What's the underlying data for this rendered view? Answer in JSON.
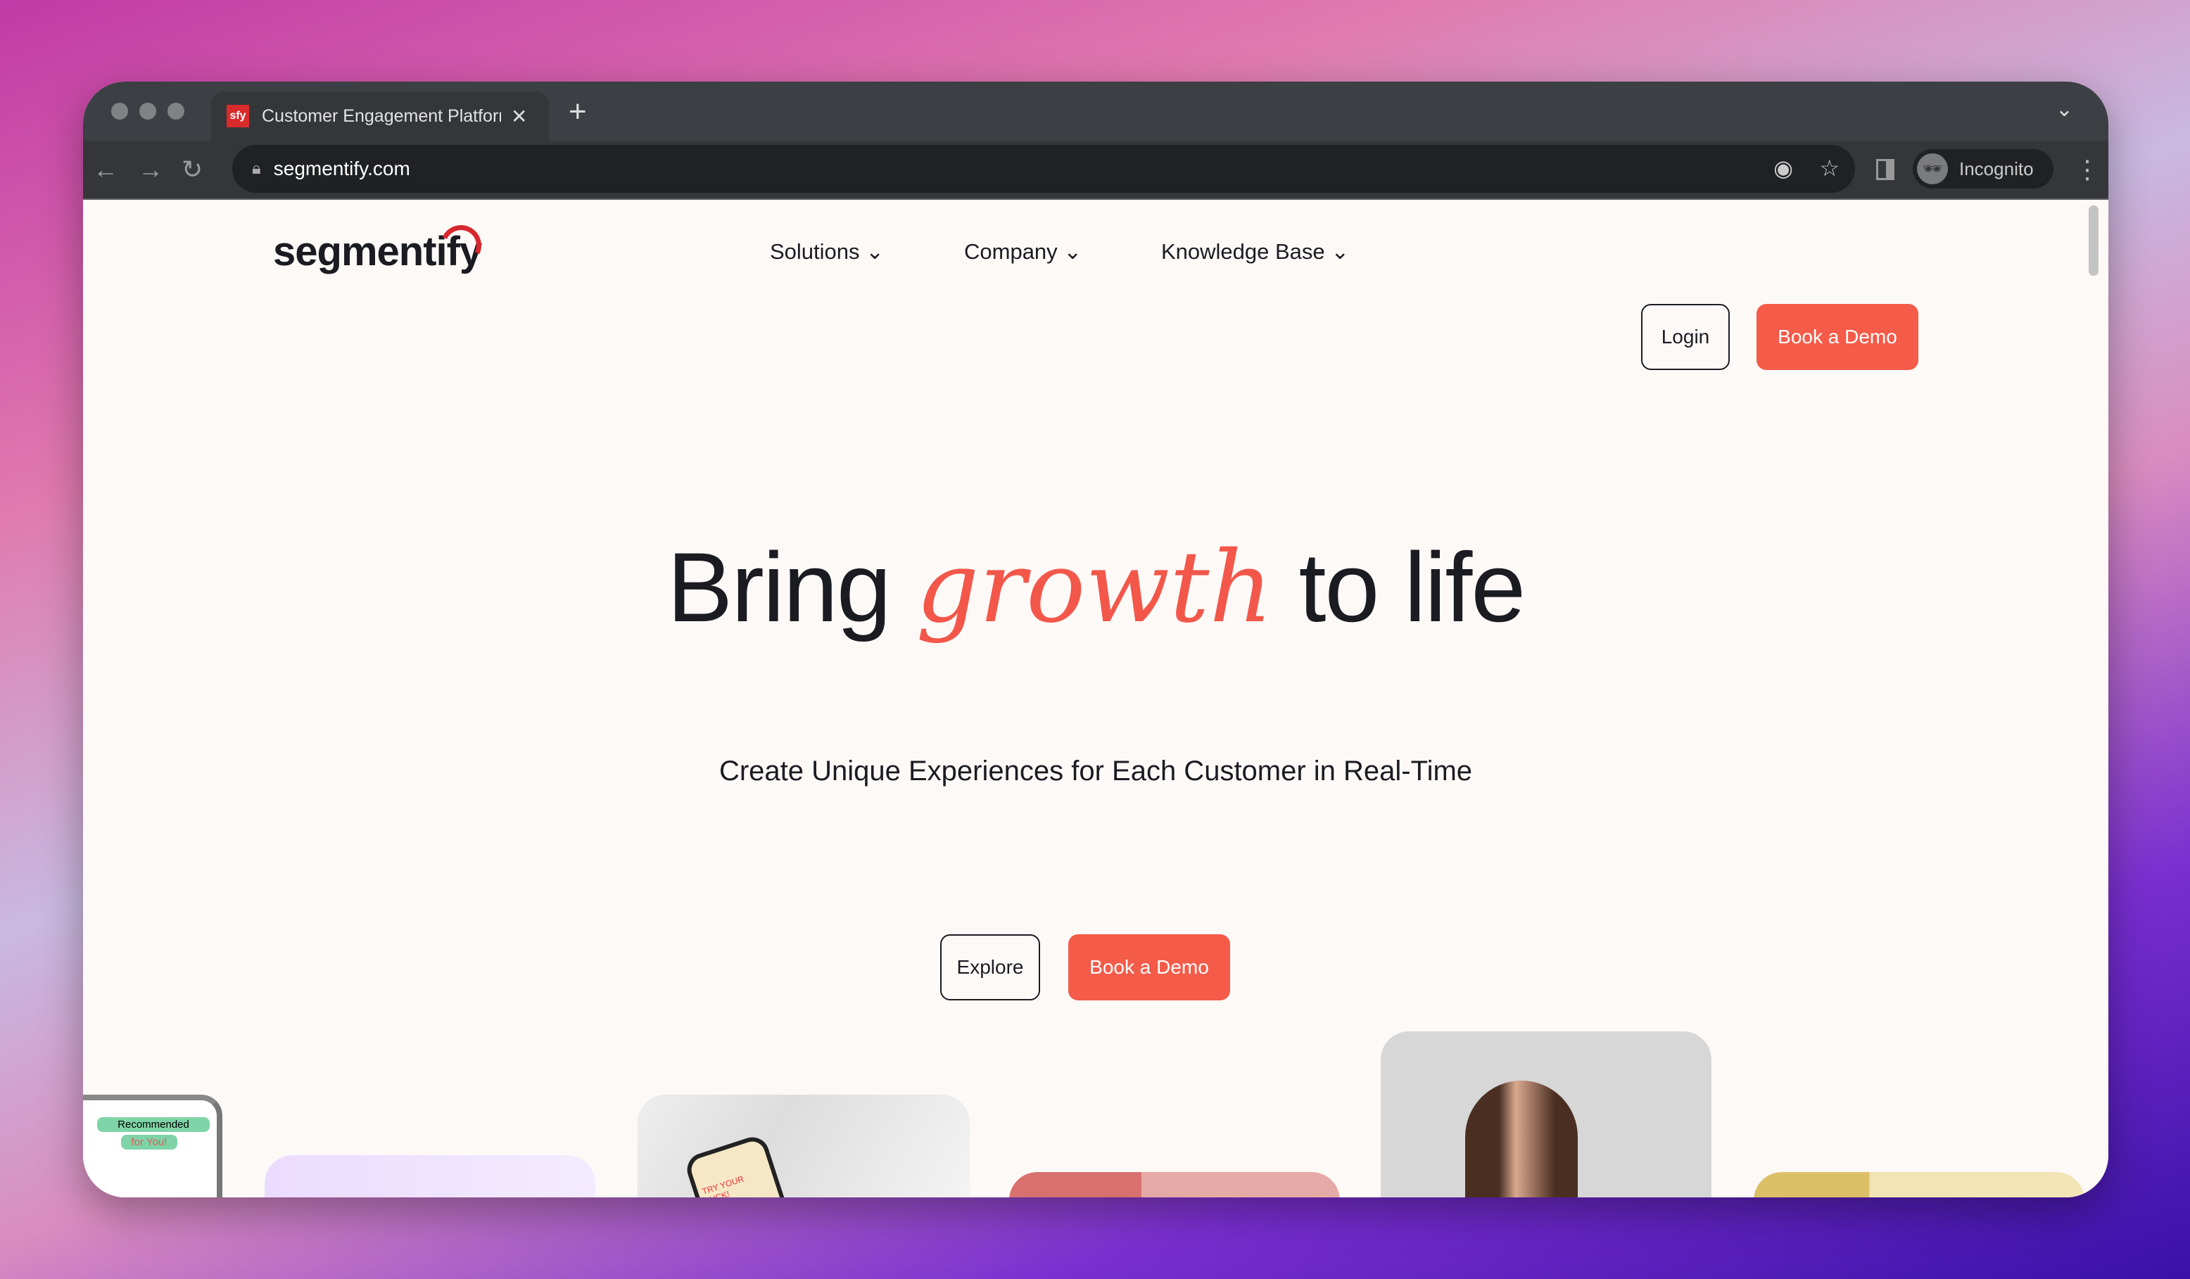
{
  "browser": {
    "tab_title": "Customer Engagement Platform",
    "favicon_text": "sfy",
    "url": "segmentify.com",
    "profile": "Incognito"
  },
  "site": {
    "logo": "segmentify",
    "nav": [
      {
        "label": "Solutions"
      },
      {
        "label": "Company"
      },
      {
        "label": "Knowledge Base"
      }
    ],
    "login": "Login",
    "book_demo": "Book a Demo"
  },
  "hero": {
    "title_pre": "Bring ",
    "title_accent": "growth",
    "title_post": " to life",
    "subtitle": "Create Unique Experiences for Each Customer in Real-Time",
    "explore": "Explore",
    "book_demo": "Book a Demo"
  },
  "cards": {
    "recommended": "Recommended",
    "for_you": "for You!",
    "try_luck": "TRY YOUR LUCK!"
  },
  "colors": {
    "accent": "#f45b49",
    "logo_arc": "#d7282f"
  }
}
